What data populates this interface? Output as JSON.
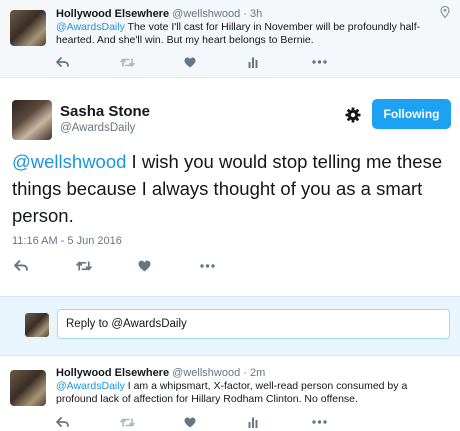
{
  "top_tweet": {
    "name": "Hollywood Elsewhere",
    "handle": "@wellshwood",
    "dot": "·",
    "time": "3h",
    "mention": "@AwardsDaily",
    "text": " The vote I'll cast for Hillary in November will be profoundly half-hearted.  And she'll win.  But my heart belongs to Bernie."
  },
  "main_tweet": {
    "name": "Sasha Stone",
    "handle": "@AwardsDaily",
    "follow_label": "Following",
    "mention": "@wellshwood",
    "text": " I wish you would stop telling me these things because I always thought of you as a smart person.",
    "timestamp": "11:16 AM - 5 Jun 2016"
  },
  "reply": {
    "placeholder": "Reply to @AwardsDaily"
  },
  "bottom_tweet": {
    "name": "Hollywood Elsewhere",
    "handle": "@wellshwood",
    "dot": "·",
    "time": "2m",
    "mention": "@AwardsDaily",
    "text": " I am a whipsmart, X-factor, well-read person consumed by a profound lack of affection for Hillary Rodham Clinton.  No offense."
  },
  "icons": {
    "reply": "reply-icon",
    "retweet": "retweet-icon",
    "like": "heart-icon",
    "analytics": "analytics-icon",
    "more": "more-icon",
    "settings": "gear-icon",
    "location": "location-pin-icon"
  },
  "colors": {
    "link": "#1b95e0",
    "follow_button": "#1da1f2",
    "icon_gray": "#aab8c2",
    "reply_area_bg": "#e8f5fd"
  }
}
